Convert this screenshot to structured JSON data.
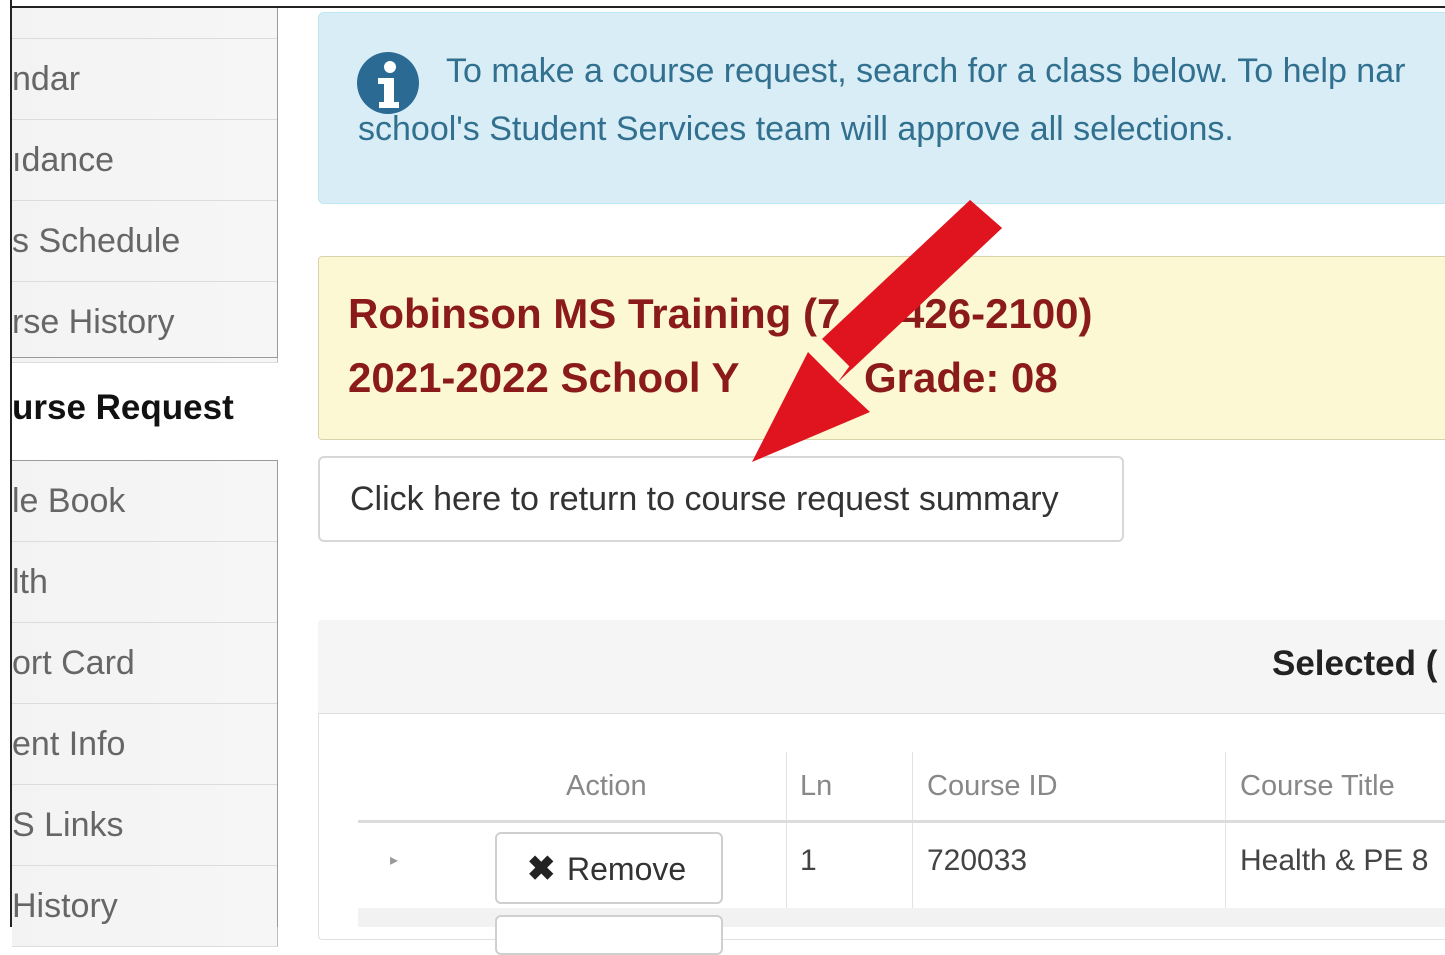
{
  "sidebar": {
    "items": [
      {
        "label": "ndar"
      },
      {
        "label": "ıdance"
      },
      {
        "label": "s Schedule"
      },
      {
        "label": "rse History"
      },
      {
        "label": "urse Request",
        "active": true
      },
      {
        "label": "le Book"
      },
      {
        "label": "lth"
      },
      {
        "label": "ort Card"
      },
      {
        "label": "ent Info"
      },
      {
        "label": "S Links"
      },
      {
        "label": "History"
      }
    ]
  },
  "info_alert": {
    "icon": "info-icon",
    "line1": "To make a course request, search for a class below. To help nar",
    "line2": "school's Student Services team will approve all selections."
  },
  "school_banner": {
    "line1": "Robinson MS Training (7_3-426-2100)",
    "line2": "2021-2022 School Y",
    "line2_tail": "Grade: 08"
  },
  "return_button": {
    "label": "Click here to return to course request summary"
  },
  "selected_panel": {
    "title": "Selected (",
    "columns": [
      "Action",
      "Ln",
      "Course ID",
      "Course Title"
    ],
    "rows": [
      {
        "action": "Remove",
        "ln": "1",
        "course_id": "720033",
        "course_title": "Health & PE 8"
      }
    ]
  },
  "annotation": {
    "arrow_color": "#e0141e"
  },
  "colors": {
    "info_bg": "#d9edf7",
    "info_text": "#31708f",
    "banner_bg": "#fcf8d3",
    "banner_text": "#8b1a1a"
  }
}
